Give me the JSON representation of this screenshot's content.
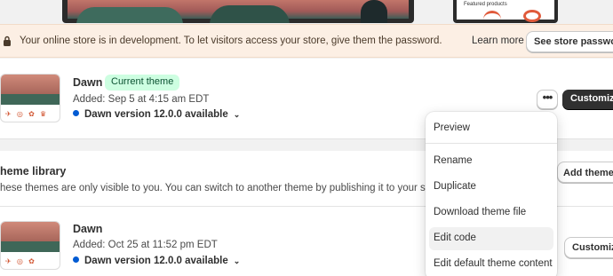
{
  "preview_strip": {
    "featured_label": "Featured products"
  },
  "banner": {
    "message": "Your online store is in development. To let visitors access your store, give them the password.",
    "learn_more": "Learn more",
    "see_password": "See store password"
  },
  "current_theme": {
    "name": "Dawn",
    "badge": "Current theme",
    "added": "Added: Sep 5 at 4:15 am EDT",
    "version": "Dawn version 12.0.0 available",
    "more_label": "•••",
    "customize": "Customize"
  },
  "library": {
    "title": "heme library",
    "description": "hese themes are only visible to you. You can switch to another theme by publishing it to your store.",
    "add_theme": "Add theme ▾",
    "theme": {
      "name": "Dawn",
      "added": "Added: Oct 25 at 11:52 pm EDT",
      "version": "Dawn version 12.0.0 available",
      "customize": "Customize"
    }
  },
  "menu": {
    "items": [
      {
        "label": "Preview"
      },
      {
        "label": "Rename"
      },
      {
        "label": "Duplicate"
      },
      {
        "label": "Download theme file"
      },
      {
        "label": "Edit code"
      },
      {
        "label": "Edit default theme content"
      }
    ]
  },
  "colors": {
    "badge_bg": "#cdfee1",
    "banner_bg": "#fcefe4",
    "version_dot": "#005bd3",
    "primary_button": "#303030"
  }
}
